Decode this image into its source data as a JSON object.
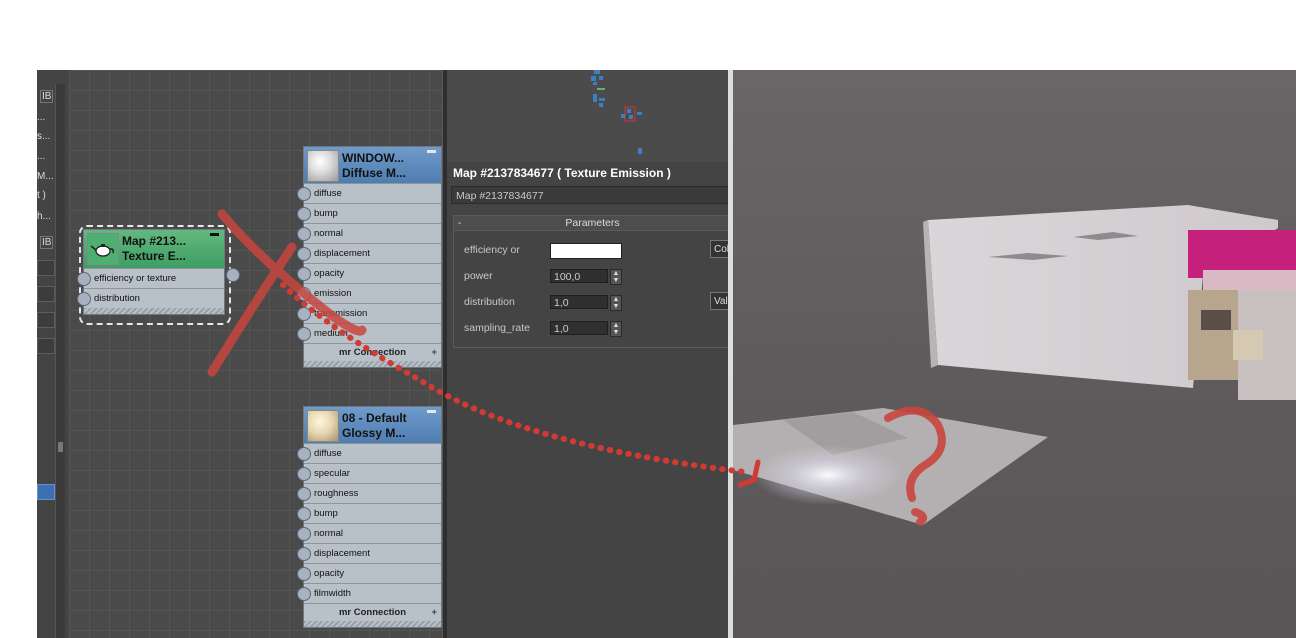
{
  "sidebar": {
    "labels": [
      "IB",
      "...",
      "s...",
      "...",
      "M...",
      "t )",
      "h...",
      "IB"
    ]
  },
  "node_editor": {
    "texture_node": {
      "title_line1": "Map #213...",
      "title_line2": "Texture E...",
      "slots": [
        "efficiency or texture",
        "distribution"
      ]
    },
    "window_node": {
      "title_line1": "WINDOW...",
      "title_line2": "Diffuse M...",
      "slots": [
        "diffuse",
        "bump",
        "normal",
        "displacement",
        "opacity",
        "emission",
        "transmission",
        "medium"
      ],
      "footer": "mr Connection"
    },
    "default_node": {
      "title_line1": "08 - Default",
      "title_line2": "Glossy M...",
      "slots": [
        "diffuse",
        "specular",
        "roughness",
        "bump",
        "normal",
        "displacement",
        "opacity",
        "filmwidth"
      ],
      "footer": "mr Connection"
    }
  },
  "parameter_panel": {
    "title": "Map #2137834677  ( Texture Emission )",
    "name_field": "Map #2137834677",
    "rollout_title": "Parameters",
    "rollout_collapse": "-",
    "params": [
      {
        "label": "efficiency or",
        "type": "color",
        "value": "",
        "side_button": "Col"
      },
      {
        "label": "power",
        "type": "spinner",
        "value": "100,0",
        "side_button": ""
      },
      {
        "label": "distribution",
        "type": "spinner",
        "value": "1,0",
        "side_button": "Valu"
      },
      {
        "label": "sampling_rate",
        "type": "spinner",
        "value": "1,0",
        "side_button": ""
      }
    ]
  },
  "colors": {
    "annotation_red": "#d23b33",
    "node_header_blue": "#4f7db0",
    "node_header_green": "#3e9e63",
    "emission_swatch": "#ffffff"
  },
  "icons": {
    "texture_node": "teapot-icon",
    "annotation": "question-mark-and-cross-out-annotations"
  }
}
